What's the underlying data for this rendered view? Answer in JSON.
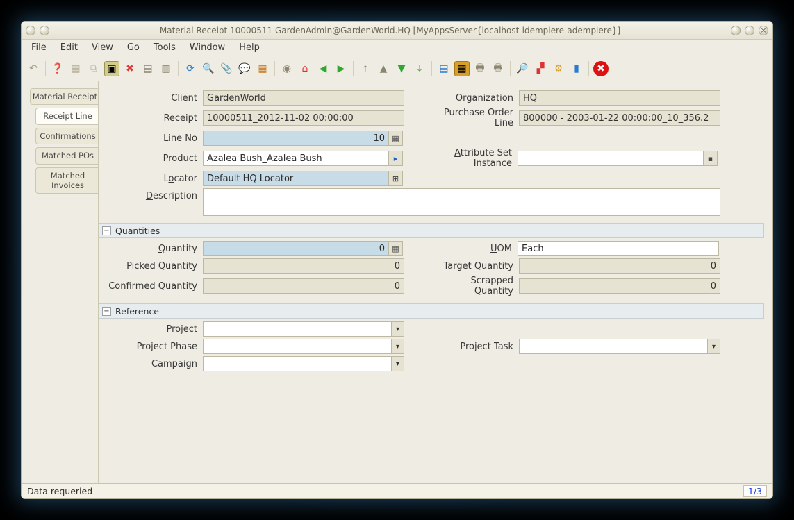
{
  "window": {
    "title": "Material Receipt  10000511  GardenAdmin@GardenWorld.HQ [MyAppsServer{localhost-idempiere-adempiere}]"
  },
  "menu": {
    "file": "File",
    "edit": "Edit",
    "view": "View",
    "go": "Go",
    "tools": "Tools",
    "window": "Window",
    "help": "Help"
  },
  "tabs": {
    "material_receipt": "Material Receipt",
    "receipt_line": "Receipt Line",
    "confirmations": "Confirmations",
    "matched_pos": "Matched POs",
    "matched_invoices": "Matched Invoices"
  },
  "labels": {
    "client": "Client",
    "organization": "Organization",
    "receipt": "Receipt",
    "po_line": "Purchase Order Line",
    "line_no": "Line No",
    "product": "Product",
    "attr_set": "Attribute Set Instance",
    "locator": "Locator",
    "description": "Description",
    "quantities": "Quantities",
    "quantity": "Quantity",
    "uom": "UOM",
    "picked_qty": "Picked Quantity",
    "target_qty": "Target Quantity",
    "confirmed_qty": "Confirmed Quantity",
    "scrapped_qty": "Scrapped Quantity",
    "reference": "Reference",
    "project": "Project",
    "project_phase": "Project Phase",
    "project_task": "Project Task",
    "campaign": "Campaign"
  },
  "values": {
    "client": "GardenWorld",
    "organization": "HQ",
    "receipt": "10000511_2012-11-02 00:00:00",
    "po_line": "800000 - 2003-01-22 00:00:00_10_356.2",
    "line_no": "10",
    "product": "Azalea Bush_Azalea Bush",
    "attr_set": "",
    "locator": "Default HQ Locator",
    "description": "",
    "quantity": "0",
    "uom": "Each",
    "picked_qty": "0",
    "target_qty": "0",
    "confirmed_qty": "0",
    "scrapped_qty": "0",
    "project": "",
    "project_phase": "",
    "project_task": "",
    "campaign": ""
  },
  "status": {
    "message": "Data requeried",
    "pager": "1/3"
  }
}
